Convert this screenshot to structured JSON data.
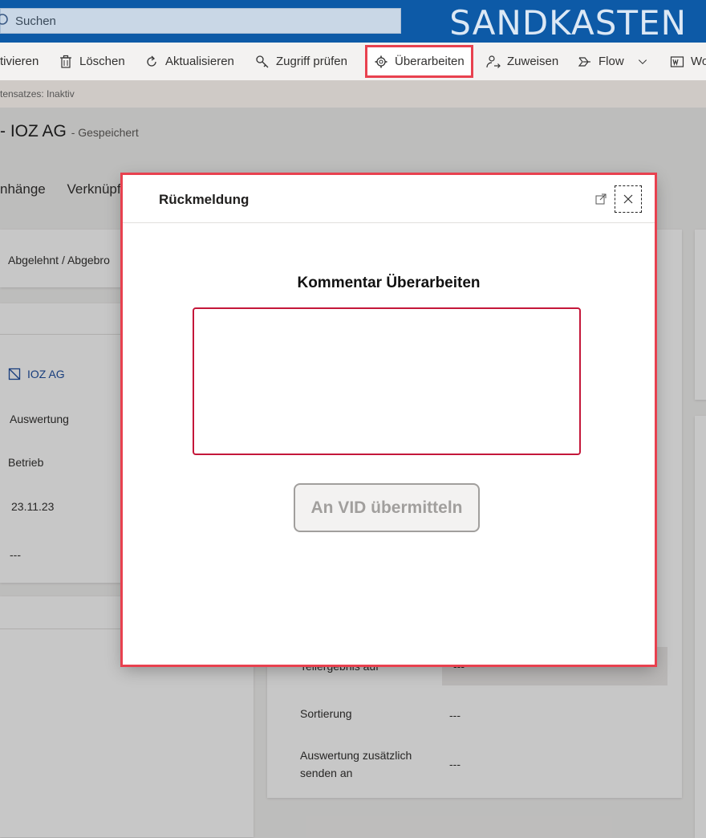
{
  "header": {
    "search_placeholder": "Suchen",
    "environment": "SANDKASTEN"
  },
  "commands": [
    {
      "label": "tivieren",
      "icon": "none"
    },
    {
      "label": "Löschen",
      "icon": "trash-icon"
    },
    {
      "label": "Aktualisieren",
      "icon": "refresh-icon"
    },
    {
      "label": "Zugriff prüfen",
      "icon": "key-icon"
    },
    {
      "label": "Überarbeiten",
      "icon": "gear-icon"
    },
    {
      "label": "Zuweisen",
      "icon": "person-arrow-icon"
    },
    {
      "label": "Flow",
      "icon": "flow-icon"
    },
    {
      "label": "Wo",
      "icon": "word-icon"
    }
  ],
  "status_strip": "tensatzes: Inaktiv",
  "record": {
    "title": "- IOZ AG",
    "saved": "- Gespeichert",
    "tabs": [
      "nhänge",
      "Verknüpf"
    ]
  },
  "background": {
    "status_value": "Abgelehnt / Abgebro",
    "account_link": "IOZ AG",
    "field_1": "Auswertung",
    "field_2": "Betrieb",
    "date": "23.11.23",
    "empty_value": "---",
    "right_fields": [
      {
        "label": "Teilergebnis auf",
        "value": "---"
      },
      {
        "label": "Sortierung",
        "value": "---"
      },
      {
        "label": "Auswertung zusätzlich senden an",
        "value": "---"
      }
    ]
  },
  "dialog": {
    "title": "Rückmeldung",
    "comment_label": "Kommentar Überarbeiten",
    "comment_value": "",
    "submit_label": "An VID übermitteln"
  },
  "colors": {
    "header_bg": "#0d5aa7",
    "highlight": "#e8414f",
    "textarea_border": "#c4173a"
  }
}
